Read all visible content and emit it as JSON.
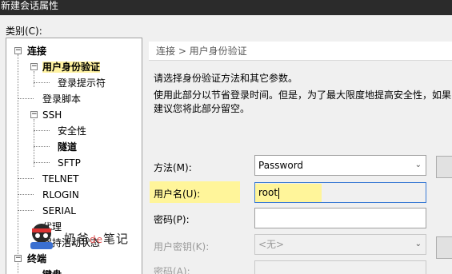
{
  "window": {
    "title": "新建会话属性"
  },
  "category_label": "类别(C):",
  "tree": {
    "items": [
      {
        "label": "连接",
        "bold": true,
        "toggle": "−"
      },
      {
        "label": "用户身份验证",
        "bold": true,
        "selected": true,
        "toggle": "−"
      },
      {
        "label": "登录提示符"
      },
      {
        "label": "登录脚本"
      },
      {
        "label": "SSH",
        "toggle": "−"
      },
      {
        "label": "安全性"
      },
      {
        "label": "隧道",
        "bold": true
      },
      {
        "label": "SFTP"
      },
      {
        "label": "TELNET"
      },
      {
        "label": "RLOGIN"
      },
      {
        "label": "SERIAL"
      },
      {
        "label": "代理"
      },
      {
        "label": "保持活动状态"
      },
      {
        "label": "终端",
        "bold": true,
        "toggle": "−"
      },
      {
        "label": "键盘",
        "bold": true
      }
    ]
  },
  "breadcrumb": "连接 > 用户身份验证",
  "description": {
    "line1": "请选择身份验证方法和其它参数。",
    "line2": "使用此部分以节省登录时间。但是，为了最大限度地提高安全性，如果",
    "line3": "建议您将此部分留空。"
  },
  "form": {
    "method_label": "方法(M):",
    "method_value": "Password",
    "username_label": "用户名(U):",
    "username_value": "root",
    "password_label": "密码(P):",
    "password_value": "",
    "user_key_label": "用户密钥(K):",
    "user_key_value": "<无>",
    "passphrase_label": "密码(A):"
  },
  "watermark": {
    "text_a": "奶爸",
    "text_de": "de",
    "text_b": "笔记"
  },
  "colors": {
    "highlight": "#fff59a",
    "titlebar": "#2b2b2b",
    "focus_border": "#3b7bd4"
  }
}
